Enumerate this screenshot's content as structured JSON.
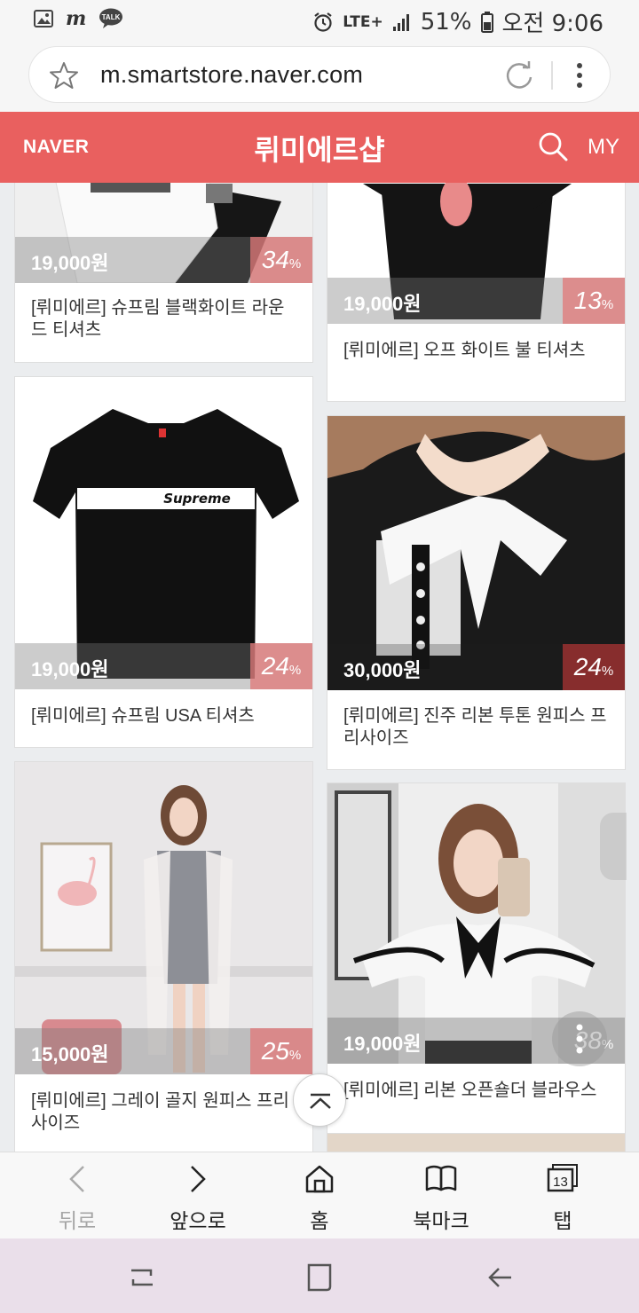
{
  "status_bar": {
    "left_icons": [
      "gallery-icon",
      "m-icon",
      "talk-icon"
    ],
    "talk_label": "TALK",
    "m_label": "m",
    "network": "LTE+",
    "battery": "51%",
    "time": "오전 9:06"
  },
  "url_bar": {
    "url": "m.smartstore.naver.com"
  },
  "header": {
    "logo": "NAVER",
    "title": "뤼미에르샵",
    "my_label": "MY"
  },
  "products": [
    {
      "price": "19,000원",
      "discount_num": "34",
      "discount_unit": "%",
      "title": "[뤼미에르] 슈프림 블랙화이트 라운드 티셔츠"
    },
    {
      "price": "19,000원",
      "discount_num": "13",
      "discount_unit": "%",
      "title": "[뤼미에르] 오프 화이트 불 티셔츠"
    },
    {
      "price": "19,000원",
      "discount_num": "24",
      "discount_unit": "%",
      "title": "[뤼미에르] 슈프림 USA 티셔츠",
      "print": "Supreme"
    },
    {
      "price": "30,000원",
      "discount_num": "24",
      "discount_unit": "%",
      "title": "[뤼미에르] 진주 리본 투톤 원피스 프리사이즈"
    },
    {
      "price": "15,000원",
      "discount_num": "25",
      "discount_unit": "%",
      "title": "[뤼미에르] 그레이 골지 원피스 프리사이즈"
    },
    {
      "price": "19,000원",
      "discount_num": "38",
      "discount_unit": "%",
      "title": "[뤼미에르] 리본 오픈숄더 블라우스"
    }
  ],
  "bottom_nav": {
    "back": "뒤로",
    "forward": "앞으로",
    "home": "홈",
    "bookmark": "북마크",
    "tabs": "탭",
    "tab_count": "13"
  }
}
